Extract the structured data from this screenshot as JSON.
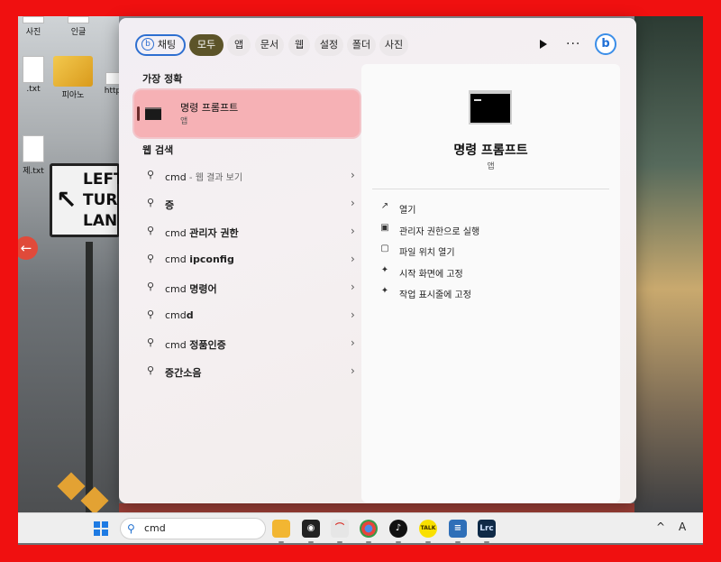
{
  "desktop": {
    "icons": [
      {
        "label": "사진",
        "type": "file"
      },
      {
        "label": "인글",
        "type": "file"
      },
      {
        "label": ".txt",
        "type": "file"
      },
      {
        "label": "피아노",
        "type": "folder"
      },
      {
        "label": "http",
        "type": "file"
      },
      {
        "label": "제.txt",
        "type": "file"
      }
    ],
    "sign_lines": [
      "LEFT",
      "TURN",
      "LANE"
    ]
  },
  "search_panel": {
    "filters": [
      {
        "label": "채팅",
        "active": false
      },
      {
        "label": "모두",
        "active": true
      },
      {
        "label": "앱",
        "active": false
      },
      {
        "label": "문서",
        "active": false
      },
      {
        "label": "웹",
        "active": false
      },
      {
        "label": "설정",
        "active": false
      },
      {
        "label": "폴더",
        "active": false
      },
      {
        "label": "사진",
        "active": false
      }
    ],
    "best_match_title": "가장 정확",
    "best_match": {
      "name": "명령 프롬프트",
      "kind": "앱"
    },
    "web_title": "웹 검색",
    "web_results": [
      {
        "prefix": "cmd",
        "bold": "",
        "hint": " - 웹 결과 보기"
      },
      {
        "prefix": "",
        "bold": "증",
        "hint": ""
      },
      {
        "prefix": "cmd ",
        "bold": "관리자 권한",
        "hint": ""
      },
      {
        "prefix": "cmd ",
        "bold": "ipconfig",
        "hint": ""
      },
      {
        "prefix": "cmd ",
        "bold": "명령어",
        "hint": ""
      },
      {
        "prefix": "cmd",
        "bold": "d",
        "hint": ""
      },
      {
        "prefix": "cmd ",
        "bold": "정품인증",
        "hint": ""
      },
      {
        "prefix": "",
        "bold": "증간소음",
        "hint": ""
      }
    ],
    "details": {
      "title": "명령 프롬프트",
      "subtitle": "앱",
      "actions": [
        {
          "label": "열기",
          "icon": "open-external-icon"
        },
        {
          "label": "관리자 권한으로 실행",
          "icon": "admin-shield-icon"
        },
        {
          "label": "파일 위치 열기",
          "icon": "folder-icon"
        },
        {
          "label": "시작 화면에 고정",
          "icon": "pin-icon"
        },
        {
          "label": "작업 표시줄에 고정",
          "icon": "pin-icon"
        }
      ]
    }
  },
  "taskbar": {
    "search_value": "cmd",
    "apps": [
      {
        "name": "file-explorer-icon",
        "color": "#f2b632",
        "glyph": ""
      },
      {
        "name": "capture-app-icon",
        "color": "#222222",
        "glyph": "◉"
      },
      {
        "name": "acrobat-icon",
        "color": "#e8e8e8",
        "glyph": "⌒"
      },
      {
        "name": "chrome-icon",
        "color": "#3a9a4a",
        "glyph": "●"
      },
      {
        "name": "tiktok-icon",
        "color": "#111111",
        "glyph": "♪"
      },
      {
        "name": "kakaotalk-icon",
        "color": "#f9e000",
        "glyph": "TALK"
      },
      {
        "name": "notepad-icon",
        "color": "#2f6fb8",
        "glyph": "≡"
      },
      {
        "name": "lightroom-classic-icon",
        "color": "#0f2a47",
        "glyph": "Lrc"
      }
    ],
    "tray": {
      "chevron": "^",
      "ime": "A"
    }
  },
  "colors": {
    "frame_red": "#f01010",
    "active_filter": "#5c5429",
    "best_match_highlight": "#f6b1b5",
    "accent_blue": "#1e6fd0"
  }
}
